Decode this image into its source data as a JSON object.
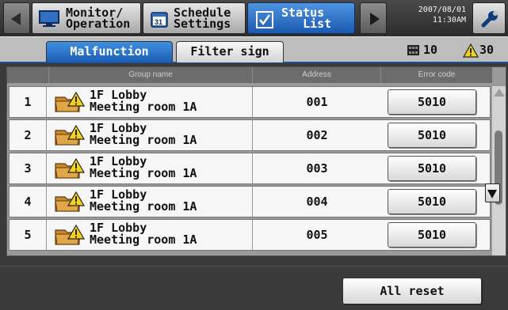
{
  "nav": {
    "monitor_label": "Monitor/\nOperation",
    "schedule_label": "Schedule\nSettings",
    "status_label": "Status\n   List",
    "datetime": "2007/08/01\n11:30AM"
  },
  "subtabs": {
    "malfunction": "Malfunction",
    "filter": "Filter sign",
    "units_count": "10",
    "errors_count": "30"
  },
  "table": {
    "headers": {
      "group": "Group name",
      "address": "Address",
      "error": "Error code"
    },
    "rows": [
      {
        "num": "1",
        "group": "1F Lobby\nMeeting room 1A",
        "address": "001",
        "error_code": "5010"
      },
      {
        "num": "2",
        "group": "1F Lobby\nMeeting room 1A",
        "address": "002",
        "error_code": "5010"
      },
      {
        "num": "3",
        "group": "1F Lobby\nMeeting room 1A",
        "address": "003",
        "error_code": "5010"
      },
      {
        "num": "4",
        "group": "1F Lobby\nMeeting room 1A",
        "address": "004",
        "error_code": "5010"
      },
      {
        "num": "5",
        "group": "1F Lobby\nMeeting room 1A",
        "address": "005",
        "error_code": "5010"
      }
    ]
  },
  "footer": {
    "all_reset": "All reset"
  },
  "colors": {
    "active_tab": "#2a6fcb",
    "warning": "#f2d21b",
    "folder": "#c98a2b"
  }
}
